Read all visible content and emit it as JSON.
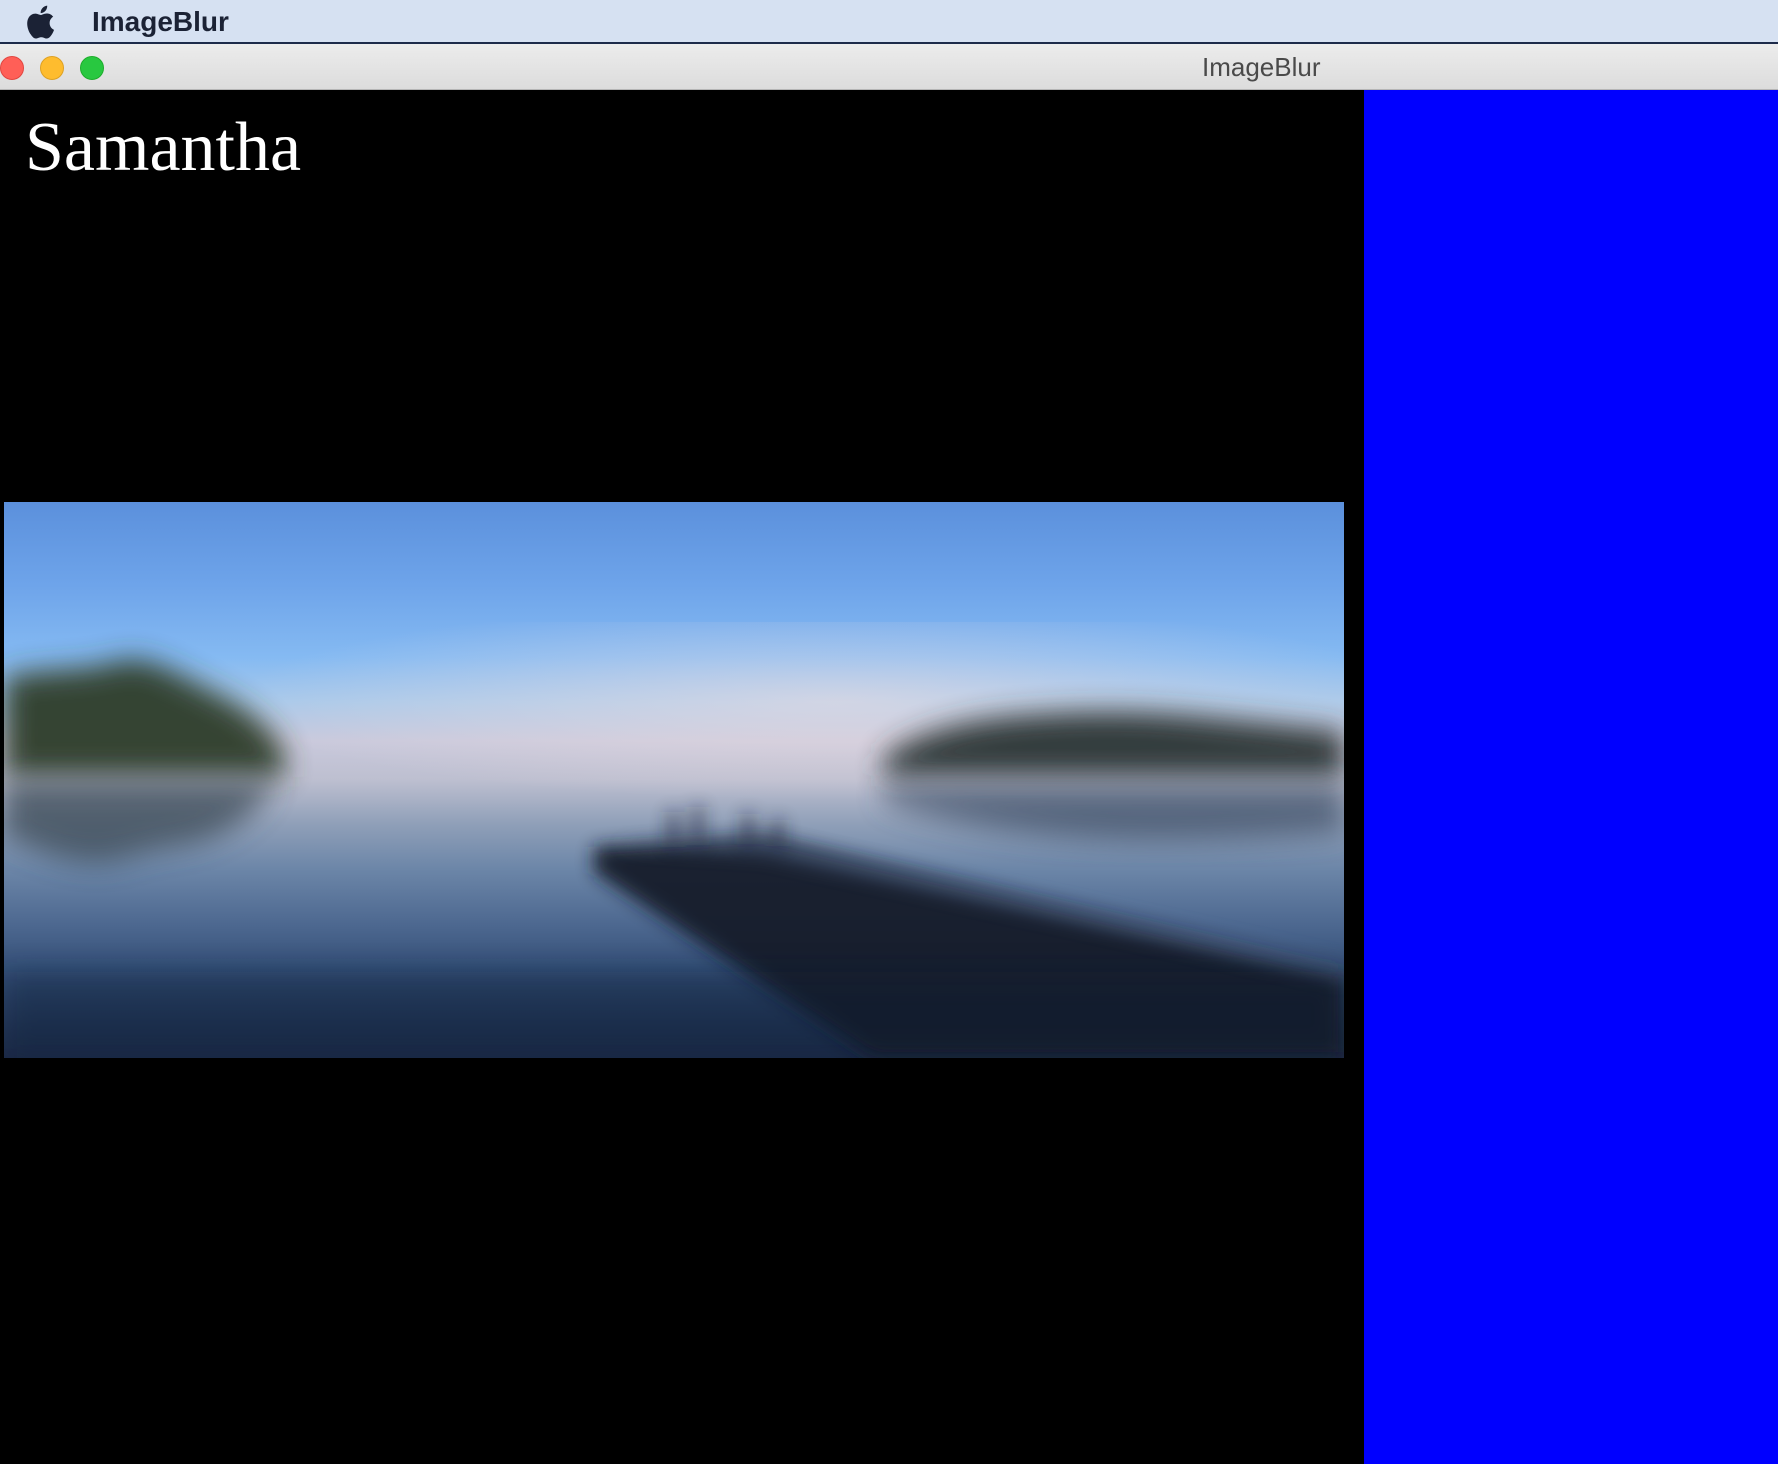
{
  "menubar": {
    "apple_icon": "apple-logo-icon",
    "app_name": "ImageBlur"
  },
  "window": {
    "title": "ImageBlur",
    "controls": {
      "close": "close-button",
      "minimize": "minimize-button",
      "zoom": "zoom-button"
    }
  },
  "content": {
    "name_label": "Samantha",
    "photo": {
      "description_icon": "blurred-lake-dock-image",
      "blurred": true
    },
    "right_panel_color": "#0000ff",
    "left_panel_color": "#000000"
  }
}
